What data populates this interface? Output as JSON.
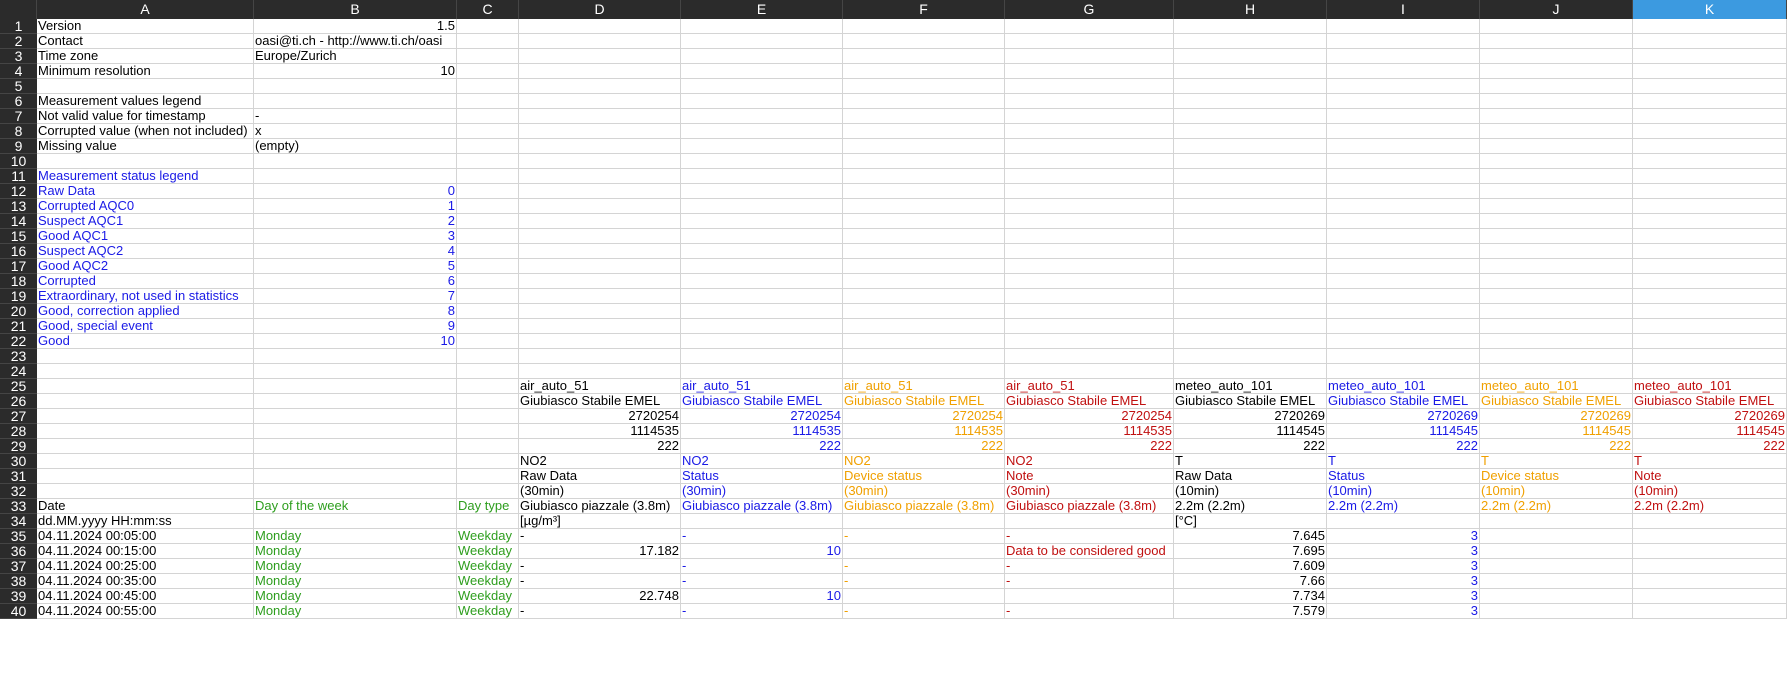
{
  "columns": [
    "A",
    "B",
    "C",
    "D",
    "E",
    "F",
    "G",
    "H",
    "I",
    "J",
    "K"
  ],
  "selected_column": "K",
  "colors": {
    "header_bg": "#2b2b2b",
    "selected_header_bg": "#3c9ae0",
    "gridline": "#d4d4d4",
    "black": "#000000",
    "blue": "#1a1ae6",
    "green": "#2e9e1e",
    "orange": "#f0a000",
    "red": "#c01010"
  },
  "rows": [
    {
      "n": "1",
      "cells": [
        {
          "c": "A",
          "v": "Version"
        },
        {
          "c": "B",
          "v": "1.5",
          "num": true
        }
      ]
    },
    {
      "n": "2",
      "cells": [
        {
          "c": "A",
          "v": "Contact"
        },
        {
          "c": "B",
          "v": "oasi@ti.ch - http://www.ti.ch/oasi"
        }
      ]
    },
    {
      "n": "3",
      "cells": [
        {
          "c": "A",
          "v": "Time zone"
        },
        {
          "c": "B",
          "v": "Europe/Zurich"
        }
      ]
    },
    {
      "n": "4",
      "cells": [
        {
          "c": "A",
          "v": "Minimum resolution"
        },
        {
          "c": "B",
          "v": "10",
          "num": true
        }
      ]
    },
    {
      "n": "5",
      "cells": []
    },
    {
      "n": "6",
      "cells": [
        {
          "c": "A",
          "v": "Measurement values legend"
        }
      ]
    },
    {
      "n": "7",
      "cells": [
        {
          "c": "A",
          "v": "Not valid value for timestamp"
        },
        {
          "c": "B",
          "v": "-"
        }
      ]
    },
    {
      "n": "8",
      "cells": [
        {
          "c": "A",
          "v": "Corrupted value (when not included)"
        },
        {
          "c": "B",
          "v": "x"
        }
      ]
    },
    {
      "n": "9",
      "cells": [
        {
          "c": "A",
          "v": "Missing value"
        },
        {
          "c": "B",
          "v": "(empty)"
        }
      ]
    },
    {
      "n": "10",
      "cells": []
    },
    {
      "n": "11",
      "cells": [
        {
          "c": "A",
          "v": "Measurement status legend",
          "col": "blue"
        }
      ]
    },
    {
      "n": "12",
      "cells": [
        {
          "c": "A",
          "v": "Raw Data",
          "col": "blue"
        },
        {
          "c": "B",
          "v": "0",
          "num": true,
          "col": "blue"
        }
      ]
    },
    {
      "n": "13",
      "cells": [
        {
          "c": "A",
          "v": "Corrupted AQC0",
          "col": "blue"
        },
        {
          "c": "B",
          "v": "1",
          "num": true,
          "col": "blue"
        }
      ]
    },
    {
      "n": "14",
      "cells": [
        {
          "c": "A",
          "v": "Suspect AQC1",
          "col": "blue"
        },
        {
          "c": "B",
          "v": "2",
          "num": true,
          "col": "blue"
        }
      ]
    },
    {
      "n": "15",
      "cells": [
        {
          "c": "A",
          "v": "Good AQC1",
          "col": "blue"
        },
        {
          "c": "B",
          "v": "3",
          "num": true,
          "col": "blue"
        }
      ]
    },
    {
      "n": "16",
      "cells": [
        {
          "c": "A",
          "v": "Suspect AQC2",
          "col": "blue"
        },
        {
          "c": "B",
          "v": "4",
          "num": true,
          "col": "blue"
        }
      ]
    },
    {
      "n": "17",
      "cells": [
        {
          "c": "A",
          "v": "Good AQC2",
          "col": "blue"
        },
        {
          "c": "B",
          "v": "5",
          "num": true,
          "col": "blue"
        }
      ]
    },
    {
      "n": "18",
      "cells": [
        {
          "c": "A",
          "v": "Corrupted",
          "col": "blue"
        },
        {
          "c": "B",
          "v": "6",
          "num": true,
          "col": "blue"
        }
      ]
    },
    {
      "n": "19",
      "cells": [
        {
          "c": "A",
          "v": "Extraordinary, not used in statistics",
          "col": "blue"
        },
        {
          "c": "B",
          "v": "7",
          "num": true,
          "col": "blue"
        }
      ]
    },
    {
      "n": "20",
      "cells": [
        {
          "c": "A",
          "v": "Good, correction applied",
          "col": "blue"
        },
        {
          "c": "B",
          "v": "8",
          "num": true,
          "col": "blue"
        }
      ]
    },
    {
      "n": "21",
      "cells": [
        {
          "c": "A",
          "v": "Good, special event",
          "col": "blue"
        },
        {
          "c": "B",
          "v": "9",
          "num": true,
          "col": "blue"
        }
      ]
    },
    {
      "n": "22",
      "cells": [
        {
          "c": "A",
          "v": "Good",
          "col": "blue"
        },
        {
          "c": "B",
          "v": "10",
          "num": true,
          "col": "blue"
        }
      ]
    },
    {
      "n": "23",
      "cells": []
    },
    {
      "n": "24",
      "cells": []
    },
    {
      "n": "25",
      "cells": [
        {
          "c": "D",
          "v": "air_auto_51"
        },
        {
          "c": "E",
          "v": "air_auto_51",
          "col": "blue"
        },
        {
          "c": "F",
          "v": "air_auto_51",
          "col": "orange"
        },
        {
          "c": "G",
          "v": "air_auto_51",
          "col": "red"
        },
        {
          "c": "H",
          "v": "meteo_auto_101"
        },
        {
          "c": "I",
          "v": "meteo_auto_101",
          "col": "blue"
        },
        {
          "c": "J",
          "v": "meteo_auto_101",
          "col": "orange"
        },
        {
          "c": "K",
          "v": "meteo_auto_101",
          "col": "red"
        }
      ]
    },
    {
      "n": "26",
      "cells": [
        {
          "c": "D",
          "v": "Giubiasco Stabile EMEL"
        },
        {
          "c": "E",
          "v": "Giubiasco Stabile EMEL",
          "col": "blue"
        },
        {
          "c": "F",
          "v": "Giubiasco Stabile EMEL",
          "col": "orange"
        },
        {
          "c": "G",
          "v": "Giubiasco Stabile EMEL",
          "col": "red"
        },
        {
          "c": "H",
          "v": "Giubiasco Stabile EMEL"
        },
        {
          "c": "I",
          "v": "Giubiasco Stabile EMEL",
          "col": "blue"
        },
        {
          "c": "J",
          "v": "Giubiasco Stabile EMEL",
          "col": "orange"
        },
        {
          "c": "K",
          "v": "Giubiasco Stabile EMEL",
          "col": "red"
        }
      ]
    },
    {
      "n": "27",
      "cells": [
        {
          "c": "D",
          "v": "2720254",
          "num": true
        },
        {
          "c": "E",
          "v": "2720254",
          "num": true,
          "col": "blue"
        },
        {
          "c": "F",
          "v": "2720254",
          "num": true,
          "col": "orange"
        },
        {
          "c": "G",
          "v": "2720254",
          "num": true,
          "col": "red"
        },
        {
          "c": "H",
          "v": "2720269",
          "num": true
        },
        {
          "c": "I",
          "v": "2720269",
          "num": true,
          "col": "blue"
        },
        {
          "c": "J",
          "v": "2720269",
          "num": true,
          "col": "orange"
        },
        {
          "c": "K",
          "v": "2720269",
          "num": true,
          "col": "red"
        }
      ]
    },
    {
      "n": "28",
      "cells": [
        {
          "c": "D",
          "v": "1114535",
          "num": true
        },
        {
          "c": "E",
          "v": "1114535",
          "num": true,
          "col": "blue"
        },
        {
          "c": "F",
          "v": "1114535",
          "num": true,
          "col": "orange"
        },
        {
          "c": "G",
          "v": "1114535",
          "num": true,
          "col": "red"
        },
        {
          "c": "H",
          "v": "1114545",
          "num": true
        },
        {
          "c": "I",
          "v": "1114545",
          "num": true,
          "col": "blue"
        },
        {
          "c": "J",
          "v": "1114545",
          "num": true,
          "col": "orange"
        },
        {
          "c": "K",
          "v": "1114545",
          "num": true,
          "col": "red"
        }
      ]
    },
    {
      "n": "29",
      "cells": [
        {
          "c": "D",
          "v": "222",
          "num": true
        },
        {
          "c": "E",
          "v": "222",
          "num": true,
          "col": "blue"
        },
        {
          "c": "F",
          "v": "222",
          "num": true,
          "col": "orange"
        },
        {
          "c": "G",
          "v": "222",
          "num": true,
          "col": "red"
        },
        {
          "c": "H",
          "v": "222",
          "num": true
        },
        {
          "c": "I",
          "v": "222",
          "num": true,
          "col": "blue"
        },
        {
          "c": "J",
          "v": "222",
          "num": true,
          "col": "orange"
        },
        {
          "c": "K",
          "v": "222",
          "num": true,
          "col": "red"
        }
      ]
    },
    {
      "n": "30",
      "cells": [
        {
          "c": "D",
          "v": "NO2"
        },
        {
          "c": "E",
          "v": "NO2",
          "col": "blue"
        },
        {
          "c": "F",
          "v": "NO2",
          "col": "orange"
        },
        {
          "c": "G",
          "v": "NO2",
          "col": "red"
        },
        {
          "c": "H",
          "v": "T"
        },
        {
          "c": "I",
          "v": "T",
          "col": "blue"
        },
        {
          "c": "J",
          "v": "T",
          "col": "orange"
        },
        {
          "c": "K",
          "v": "T",
          "col": "red"
        }
      ]
    },
    {
      "n": "31",
      "cells": [
        {
          "c": "D",
          "v": "Raw Data"
        },
        {
          "c": "E",
          "v": "Status",
          "col": "blue"
        },
        {
          "c": "F",
          "v": "Device status",
          "col": "orange"
        },
        {
          "c": "G",
          "v": "Note",
          "col": "red"
        },
        {
          "c": "H",
          "v": "Raw Data"
        },
        {
          "c": "I",
          "v": "Status",
          "col": "blue"
        },
        {
          "c": "J",
          "v": "Device status",
          "col": "orange"
        },
        {
          "c": "K",
          "v": "Note",
          "col": "red"
        }
      ]
    },
    {
      "n": "32",
      "cells": [
        {
          "c": "D",
          "v": "(30min)"
        },
        {
          "c": "E",
          "v": "(30min)",
          "col": "blue"
        },
        {
          "c": "F",
          "v": "(30min)",
          "col": "orange"
        },
        {
          "c": "G",
          "v": "(30min)",
          "col": "red"
        },
        {
          "c": "H",
          "v": "(10min)"
        },
        {
          "c": "I",
          "v": "(10min)",
          "col": "blue"
        },
        {
          "c": "J",
          "v": "(10min)",
          "col": "orange"
        },
        {
          "c": "K",
          "v": "(10min)",
          "col": "red"
        }
      ]
    },
    {
      "n": "33",
      "cells": [
        {
          "c": "A",
          "v": "Date"
        },
        {
          "c": "B",
          "v": "Day of the week",
          "col": "green"
        },
        {
          "c": "C",
          "v": "Day type",
          "col": "green"
        },
        {
          "c": "D",
          "v": "Giubiasco piazzale (3.8m)"
        },
        {
          "c": "E",
          "v": "Giubiasco piazzale (3.8m)",
          "col": "blue"
        },
        {
          "c": "F",
          "v": "Giubiasco piazzale (3.8m)",
          "col": "orange"
        },
        {
          "c": "G",
          "v": "Giubiasco piazzale (3.8m)",
          "col": "red"
        },
        {
          "c": "H",
          "v": "2.2m (2.2m)"
        },
        {
          "c": "I",
          "v": "2.2m (2.2m)",
          "col": "blue"
        },
        {
          "c": "J",
          "v": "2.2m (2.2m)",
          "col": "orange"
        },
        {
          "c": "K",
          "v": "2.2m (2.2m)",
          "col": "red"
        }
      ]
    },
    {
      "n": "34",
      "cells": [
        {
          "c": "A",
          "v": "dd.MM.yyyy HH:mm:ss"
        },
        {
          "c": "D",
          "v": "[µg/m³]"
        },
        {
          "c": "H",
          "v": "[°C]"
        }
      ]
    },
    {
      "n": "35",
      "cells": [
        {
          "c": "A",
          "v": "04.11.2024 00:05:00"
        },
        {
          "c": "B",
          "v": "Monday",
          "col": "green"
        },
        {
          "c": "C",
          "v": "Weekday",
          "col": "green"
        },
        {
          "c": "D",
          "v": "-"
        },
        {
          "c": "E",
          "v": "-",
          "col": "blue"
        },
        {
          "c": "F",
          "v": "-",
          "col": "orange"
        },
        {
          "c": "G",
          "v": "-",
          "col": "red"
        },
        {
          "c": "H",
          "v": "7.645",
          "num": true
        },
        {
          "c": "I",
          "v": "3",
          "num": true,
          "col": "blue"
        }
      ]
    },
    {
      "n": "36",
      "cells": [
        {
          "c": "A",
          "v": "04.11.2024 00:15:00"
        },
        {
          "c": "B",
          "v": "Monday",
          "col": "green"
        },
        {
          "c": "C",
          "v": "Weekday",
          "col": "green"
        },
        {
          "c": "D",
          "v": "17.182",
          "num": true
        },
        {
          "c": "E",
          "v": "10",
          "num": true,
          "col": "blue"
        },
        {
          "c": "G",
          "v": "Data to be considered good",
          "col": "red"
        },
        {
          "c": "H",
          "v": "7.695",
          "num": true
        },
        {
          "c": "I",
          "v": "3",
          "num": true,
          "col": "blue"
        }
      ]
    },
    {
      "n": "37",
      "cells": [
        {
          "c": "A",
          "v": "04.11.2024 00:25:00"
        },
        {
          "c": "B",
          "v": "Monday",
          "col": "green"
        },
        {
          "c": "C",
          "v": "Weekday",
          "col": "green"
        },
        {
          "c": "D",
          "v": "-"
        },
        {
          "c": "E",
          "v": "-",
          "col": "blue"
        },
        {
          "c": "F",
          "v": "-",
          "col": "orange"
        },
        {
          "c": "G",
          "v": "-",
          "col": "red"
        },
        {
          "c": "H",
          "v": "7.609",
          "num": true
        },
        {
          "c": "I",
          "v": "3",
          "num": true,
          "col": "blue"
        }
      ]
    },
    {
      "n": "38",
      "cells": [
        {
          "c": "A",
          "v": "04.11.2024 00:35:00"
        },
        {
          "c": "B",
          "v": "Monday",
          "col": "green"
        },
        {
          "c": "C",
          "v": "Weekday",
          "col": "green"
        },
        {
          "c": "D",
          "v": "-"
        },
        {
          "c": "E",
          "v": "-",
          "col": "blue"
        },
        {
          "c": "F",
          "v": "-",
          "col": "orange"
        },
        {
          "c": "G",
          "v": "-",
          "col": "red"
        },
        {
          "c": "H",
          "v": "7.66",
          "num": true
        },
        {
          "c": "I",
          "v": "3",
          "num": true,
          "col": "blue"
        }
      ]
    },
    {
      "n": "39",
      "cells": [
        {
          "c": "A",
          "v": "04.11.2024 00:45:00"
        },
        {
          "c": "B",
          "v": "Monday",
          "col": "green"
        },
        {
          "c": "C",
          "v": "Weekday",
          "col": "green"
        },
        {
          "c": "D",
          "v": "22.748",
          "num": true
        },
        {
          "c": "E",
          "v": "10",
          "num": true,
          "col": "blue"
        },
        {
          "c": "H",
          "v": "7.734",
          "num": true
        },
        {
          "c": "I",
          "v": "3",
          "num": true,
          "col": "blue"
        }
      ]
    },
    {
      "n": "40",
      "cells": [
        {
          "c": "A",
          "v": "04.11.2024 00:55:00"
        },
        {
          "c": "B",
          "v": "Monday",
          "col": "green"
        },
        {
          "c": "C",
          "v": "Weekday",
          "col": "green"
        },
        {
          "c": "D",
          "v": "-"
        },
        {
          "c": "E",
          "v": "-",
          "col": "blue"
        },
        {
          "c": "F",
          "v": "-",
          "col": "orange"
        },
        {
          "c": "G",
          "v": "-",
          "col": "red"
        },
        {
          "c": "H",
          "v": "7.579",
          "num": true
        },
        {
          "c": "I",
          "v": "3",
          "num": true,
          "col": "blue"
        }
      ]
    }
  ]
}
